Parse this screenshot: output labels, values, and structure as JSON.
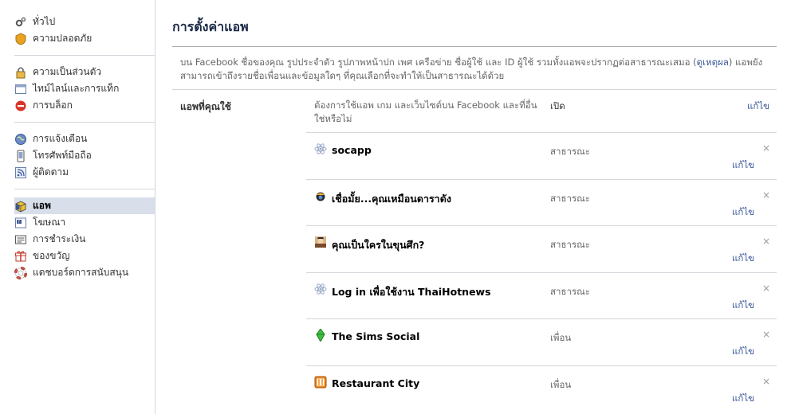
{
  "sidebar": {
    "group1": [
      {
        "label": "ทั่วไป",
        "icon": "gears-icon"
      },
      {
        "label": "ความปลอดภัย",
        "icon": "badge-icon"
      }
    ],
    "group2": [
      {
        "label": "ความเป็นส่วนตัว",
        "icon": "lock-icon"
      },
      {
        "label": "ไทม์ไลน์และการแท็ก",
        "icon": "timeline-icon"
      },
      {
        "label": "การบล็อก",
        "icon": "block-icon"
      }
    ],
    "group3": [
      {
        "label": "การแจ้งเตือน",
        "icon": "globe-icon"
      },
      {
        "label": "โทรศัพท์มือถือ",
        "icon": "mobile-icon"
      },
      {
        "label": "ผู้ติดตาม",
        "icon": "rss-icon"
      }
    ],
    "group4": [
      {
        "label": "แอพ",
        "icon": "apps-icon",
        "active": true
      },
      {
        "label": "โฆษณา",
        "icon": "ads-icon"
      },
      {
        "label": "การชำระเงิน",
        "icon": "payments-icon"
      },
      {
        "label": "ของขวัญ",
        "icon": "gift-icon"
      },
      {
        "label": "แดชบอร์ดการสนับสนุน",
        "icon": "support-icon"
      }
    ]
  },
  "main": {
    "title": "การตั้งค่าแอพ",
    "intro_text": "บน Facebook ชื่อของคุณ รูปประจำตัว รูปภาพหน้าปก เพศ เครือข่าย ชื่อผู้ใช้ และ ID ผู้ใช้ รวมทั้งแอพจะปรากฏต่อสาธารณะเสมอ (",
    "intro_link": "ดูเหตุผล",
    "intro_text2": ") แอพยังสามารถเข้าถึงรายชื่อเพื่อนและข้อมูลใดๆ ที่คุณเลือกที่จะทำให้เป็นสาธารณะได้ด้วย",
    "section_label": "แอพที่คุณใช้",
    "header_desc": "ต้องการใช้แอพ เกม และเว็บไซต์บน Facebook และที่อื่นใช่หรือไม่",
    "header_col": "เปิด",
    "header_edit": "แก้ไข",
    "apps": [
      {
        "name": "socapp",
        "privacy": "สาธารณะ",
        "edit": "แก้ไข",
        "remove": "×",
        "icon": "atom-icon"
      },
      {
        "name": "เชื่อมั้ย...คุณเหมือนดาราดัง",
        "privacy": "สาธารณะ",
        "edit": "แก้ไข",
        "remove": "×",
        "icon": "star-app-icon"
      },
      {
        "name": "คุณเป็นใครในขุนศึก?",
        "privacy": "สาธารณะ",
        "edit": "แก้ไข",
        "remove": "×",
        "icon": "warrior-app-icon"
      },
      {
        "name": "Log in เพื่อใช้งาน ThaiHotnews",
        "privacy": "สาธารณะ",
        "edit": "แก้ไข",
        "remove": "×",
        "icon": "atom-icon"
      },
      {
        "name": "The Sims Social",
        "privacy": "เพื่อน",
        "edit": "แก้ไข",
        "remove": "×",
        "icon": "sims-plumbob-icon"
      },
      {
        "name": "Restaurant City",
        "privacy": "เพื่อน",
        "edit": "แก้ไข",
        "remove": "×",
        "icon": "restaurant-icon"
      }
    ]
  }
}
